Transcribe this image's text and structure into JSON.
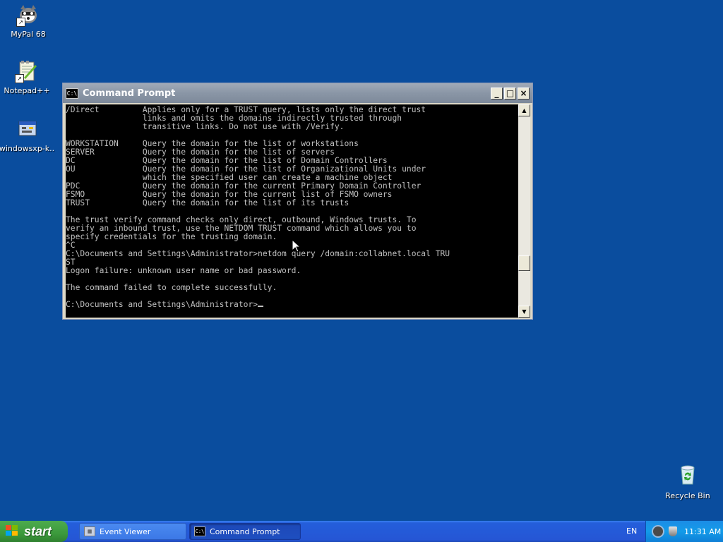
{
  "desktop": {
    "icons": [
      {
        "label": "MyPal 68",
        "icon": "mypal-icon"
      },
      {
        "label": "Notepad++",
        "icon": "notepad-plus-plus-icon"
      },
      {
        "label": "windowsxp-k..",
        "icon": "installer-icon"
      }
    ],
    "recycle_bin": {
      "label": "Recycle Bin",
      "icon": "recycle-bin-icon"
    }
  },
  "window": {
    "title": "Command Prompt",
    "console_lines": [
      "/Direct         Applies only for a TRUST query, lists only the direct trust",
      "                links and omits the domains indirectly trusted through",
      "                transitive links. Do not use with /Verify.",
      "",
      "WORKSTATION     Query the domain for the list of workstations",
      "SERVER          Query the domain for the list of servers",
      "DC              Query the domain for the list of Domain Controllers",
      "OU              Query the domain for the list of Organizational Units under",
      "                which the specified user can create a machine object",
      "PDC             Query the domain for the current Primary Domain Controller",
      "FSMO            Query the domain for the current list of FSMO owners",
      "TRUST           Query the domain for the list of its trusts",
      "",
      "The trust verify command checks only direct, outbound, Windows trusts. To",
      "verify an inbound trust, use the NETDOM TRUST command which allows you to",
      "specify credentials for the trusting domain.",
      "^C",
      "C:\\Documents and Settings\\Administrator>netdom query /domain:collabnet.local TRU",
      "ST",
      "Logon failure: unknown user name or bad password.",
      "",
      "The command failed to complete successfully.",
      ""
    ],
    "prompt": "C:\\Documents and Settings\\Administrator>"
  },
  "taskbar": {
    "start_label": "start",
    "tasks": [
      {
        "label": "Event Viewer",
        "icon": "event-viewer-icon"
      },
      {
        "label": "Command Prompt",
        "icon": "command-prompt-icon"
      }
    ],
    "language": "EN",
    "clock": "11:31 AM"
  },
  "colors": {
    "desktop": "#0a4d9e",
    "console_bg": "#000000",
    "console_text": "#c0c0c0",
    "taskbar": "#245edb",
    "start": "#3c9a3c",
    "tray": "#139be9"
  }
}
